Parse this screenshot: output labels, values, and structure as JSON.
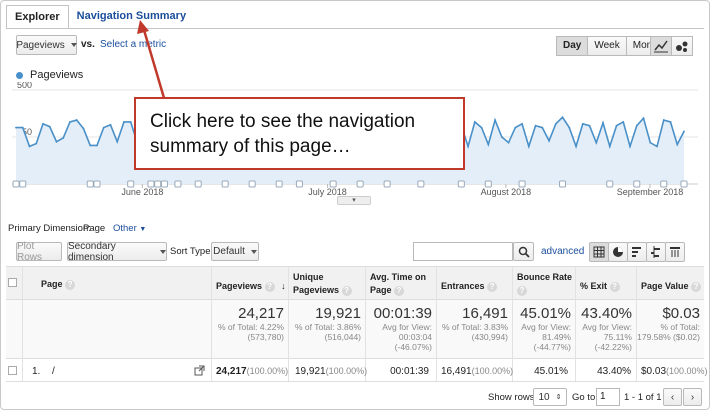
{
  "tabs": {
    "explorer": "Explorer",
    "navigation_summary": "Navigation Summary"
  },
  "metric": {
    "selected": "Pageviews",
    "vs": "vs.",
    "select_metric": "Select a metric"
  },
  "period": {
    "day": "Day",
    "week": "Week",
    "month": "Month",
    "active": "Day"
  },
  "legend": {
    "series": "Pageviews",
    "color": "#4a90c8"
  },
  "callout": {
    "text": "Click here to see the navigation summary of this page…",
    "border_color": "#c0392b"
  },
  "chart_data": {
    "type": "area",
    "series": [
      {
        "name": "Pageviews",
        "values": [
          300,
          300,
          200,
          215,
          320,
          305,
          225,
          245,
          330,
          340,
          295,
          205,
          205,
          300,
          315,
          225,
          330,
          330,
          215,
          255,
          310,
          200,
          345,
          355,
          295,
          210,
          315,
          325,
          220,
          340,
          350,
          300,
          310,
          230,
          320,
          305,
          215,
          330,
          200,
          330,
          310,
          300,
          240,
          320,
          300,
          200,
          310,
          200,
          320,
          330,
          220,
          300,
          200,
          310,
          300,
          220,
          330,
          310,
          200,
          340,
          335,
          210,
          310,
          300,
          220,
          320,
          310,
          200,
          330,
          300,
          210,
          340,
          250,
          220,
          300,
          320,
          200,
          310,
          300,
          230,
          320,
          355,
          300,
          200,
          320,
          310,
          220,
          325,
          200,
          310,
          330,
          200,
          310,
          350,
          220,
          200,
          340,
          330,
          210,
          280
        ]
      }
    ],
    "ylabel_ticks": [
      "500",
      "250"
    ],
    "ylim": [
      0,
      500
    ],
    "x_labels": [
      "June 2018",
      "July 2018",
      "August 2018",
      "September 2018"
    ],
    "color": "#4a90c8",
    "fill": "#e3eef8"
  },
  "dims": {
    "primary_label": "Primary Dimension:",
    "primary_value": "Page",
    "other": "Other"
  },
  "toolbar": {
    "plot_rows": "Plot Rows",
    "secondary": "Secondary dimension",
    "sort_label": "Sort Type:",
    "sort_value": "Default",
    "advanced": "advanced"
  },
  "columns": {
    "page": "Page",
    "pageviews": "Pageviews",
    "unique": "Unique Pageviews",
    "avg_time": "Avg. Time on Page",
    "entrances": "Entrances",
    "bounce": "Bounce Rate",
    "exit": "% Exit",
    "value": "Page Value"
  },
  "totals": {
    "pageviews": {
      "value": "24,217",
      "l1": "% of Total: 4.22%",
      "l2": "(573,780)"
    },
    "unique": {
      "value": "19,921",
      "l1": "% of Total: 3.86%",
      "l2": "(516,044)"
    },
    "avg_time": {
      "value": "00:01:39",
      "l1": "Avg for View:",
      "l2": "00:03:04",
      "l3": "(-46.07%)"
    },
    "entrances": {
      "value": "16,491",
      "l1": "% of Total: 3.83%",
      "l2": "(430,994)"
    },
    "bounce": {
      "value": "45.01%",
      "l1": "Avg for View:",
      "l2": "81.49%",
      "l3": "(-44.77%)"
    },
    "exit": {
      "value": "43.40%",
      "l1": "Avg for View:",
      "l2": "75.11%",
      "l3": "(-42.22%)"
    },
    "value": {
      "value": "$0.03",
      "l1": "% of Total:",
      "l2": "179.58% ($0.02)"
    }
  },
  "row": {
    "index": "1.",
    "page": "/",
    "pageviews": "24,217",
    "pageviews_pct": "(100.00%)",
    "unique": "19,921",
    "unique_pct": "(100.00%)",
    "avg_time": "00:01:39",
    "entrances": "16,491",
    "entrances_pct": "(100.00%)",
    "bounce": "45.01%",
    "exit": "43.40%",
    "value": "$0.03",
    "value_pct": "(100.00%)"
  },
  "pager": {
    "show_rows": "Show rows:",
    "rows": "10",
    "goto": "Go to:",
    "page": "1",
    "range": "1 - 1 of 1"
  }
}
